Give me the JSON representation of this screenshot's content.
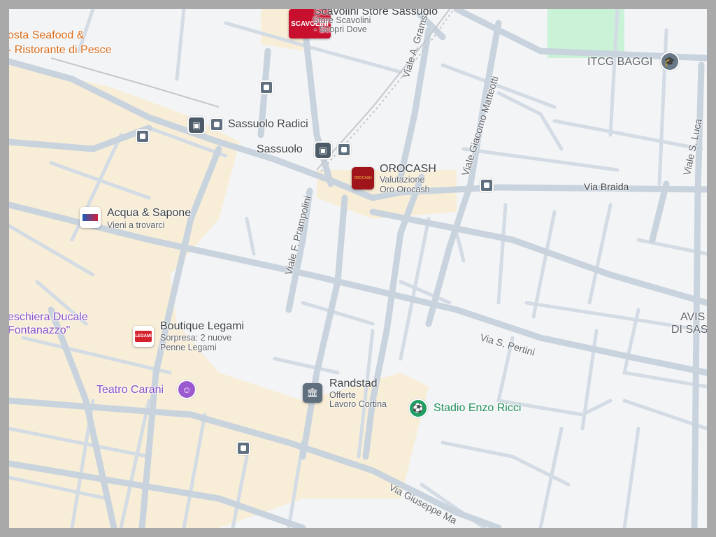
{
  "map": {
    "streets": {
      "via_braida": "Via Braida",
      "viale_gramsci": "Viale A. Gramsci",
      "viale_matteotti": "Viale Giacomo Matteotti",
      "viale_prampolini": "Viale F. Prampolini",
      "via_pertini": "Via S. Pertini",
      "via_mazzini": "Via Giuseppe Ma",
      "viale_luca": "Viale S. Luca"
    },
    "stations": {
      "sassuolo_radici": "Sassuolo Radici",
      "sassuolo": "Sassuolo"
    },
    "pois": {
      "scavolini": {
        "title": "Scavolini Store Sassuolo",
        "sub1": "Store Scavolini",
        "sub2": "- Scopri Dove",
        "logo": "SCAVOLINI"
      },
      "orocash": {
        "title": "OROCASH",
        "sub1": "Valutazione",
        "sub2": "Oro Orocash",
        "logo": "OROCASH"
      },
      "acqua": {
        "title": "Acqua & Sapone",
        "sub1": "Vieni a trovarci"
      },
      "legami": {
        "title": "Boutique Legami",
        "sub1": "Sorpresa: 2 nuove",
        "sub2": "Penne Legami",
        "logo": "LEGAMI"
      },
      "randstad": {
        "title": "Randstad",
        "sub1": "Offerte",
        "sub2": "Lavoro Cortina"
      },
      "seafood": {
        "line1": "osta Seafood &",
        "line2": "- Ristorante di Pesce"
      },
      "peschiera": {
        "line1": "eschiera Ducale",
        "line2": "Fontanazzo\""
      },
      "teatro": {
        "title": "Teatro Carani"
      },
      "stadio": {
        "title": "Stadio Enzo Ricci"
      },
      "itcg": {
        "title": "ITCG BAGGI"
      },
      "avis": {
        "line1": "AVIS",
        "line2": "DI SAS"
      }
    },
    "colors": {
      "background": "#f3f4f6",
      "road": "#c8d3de",
      "district": "#f8eed7",
      "park": "#c9f2d7",
      "rail": "#c3c8ce"
    }
  }
}
